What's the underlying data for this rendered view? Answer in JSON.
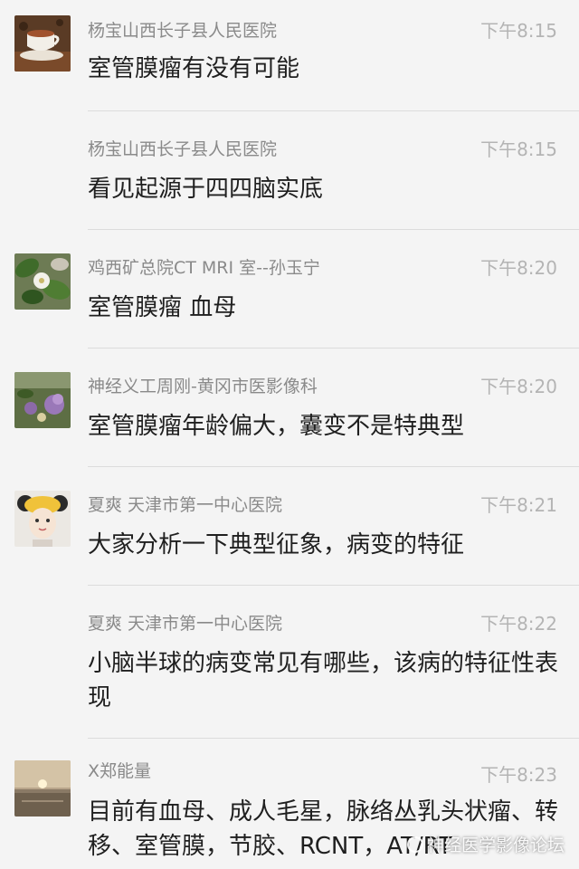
{
  "messages": [
    {
      "sender": "杨宝山西长子县人民医院",
      "time": "下午8:15",
      "text": "室管膜瘤有没有可能",
      "avatar": "coffee-cup-avatar"
    },
    {
      "sender": "杨宝山西长子县人民医院",
      "time": "下午8:15",
      "text": "看见起源于四四脑实底",
      "avatar": ""
    },
    {
      "sender": "鸡西矿总院CT MRI 室--孙玉宁",
      "time": "下午8:20",
      "text": "室管膜瘤 血母",
      "avatar": "flower-leaves-avatar"
    },
    {
      "sender": "神经义工周刚-黄冈市医影像科",
      "time": "下午8:20",
      "text": "室管膜瘤年龄偏大，囊变不是特典型",
      "avatar": "purple-flowers-avatar"
    },
    {
      "sender": "夏爽 天津市第一中心医院",
      "time": "下午8:21",
      "text": "大家分析一下典型征象，病变的特征",
      "avatar": "cartoon-girl-avatar"
    },
    {
      "sender": "夏爽 天津市第一中心医院",
      "time": "下午8:22",
      "text": "小脑半球的病变常见有哪些，该病的特征性表现",
      "avatar": ""
    },
    {
      "sender": "X郑能量",
      "time": "下午8:23",
      "text": "目前有血母、成人毛星，脉络丛乳头状瘤、转移、室管膜，节胶、RCNT，AT/RT",
      "avatar": "sunset-beach-avatar"
    }
  ],
  "watermark": "神经医学影像论坛"
}
